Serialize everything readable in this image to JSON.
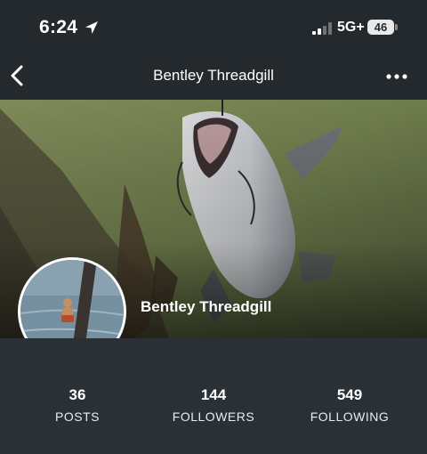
{
  "status_bar": {
    "time": "6:24",
    "network": "5G+",
    "battery": "46"
  },
  "nav": {
    "title": "Bentley Threadgill"
  },
  "profile": {
    "name": "Bentley Threadgill"
  },
  "stats": [
    {
      "count": "36",
      "label": "POSTS"
    },
    {
      "count": "144",
      "label": "FOLLOWERS"
    },
    {
      "count": "549",
      "label": "FOLLOWING"
    }
  ],
  "icons": {
    "location": "location-arrow-icon",
    "signal": "signal-bars-icon",
    "back": "chevron-left-icon",
    "more": "more-dots-icon"
  },
  "colors": {
    "header_bg": "#24292d",
    "stats_bg": "#2a3136",
    "text": "#ffffff"
  }
}
